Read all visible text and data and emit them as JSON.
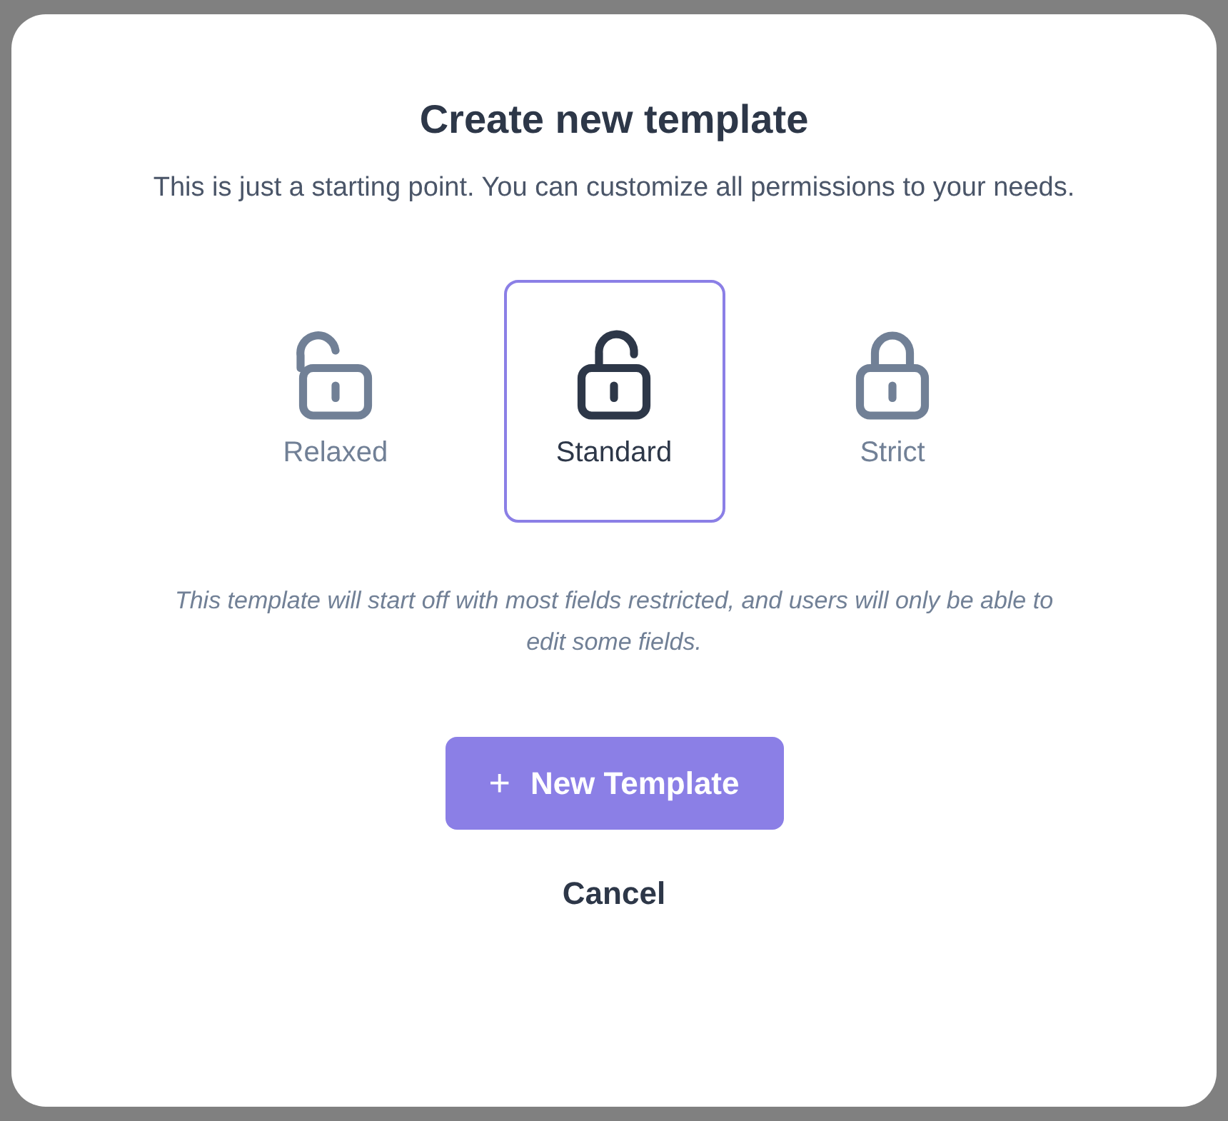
{
  "dialog": {
    "title": "Create new template",
    "subtitle": "This is just a starting point. You can customize all permissions to your needs.",
    "options": [
      {
        "kind": "open",
        "label": "Relaxed",
        "selected": false
      },
      {
        "kind": "ajar",
        "label": "Standard",
        "selected": true
      },
      {
        "kind": "closed",
        "label": "Strict",
        "selected": false
      }
    ],
    "description": "This template will start off with most fields restricted, and users will only be able to edit some fields.",
    "primary_button": {
      "icon": "+",
      "label": "New Template"
    },
    "cancel_button": "Cancel"
  }
}
